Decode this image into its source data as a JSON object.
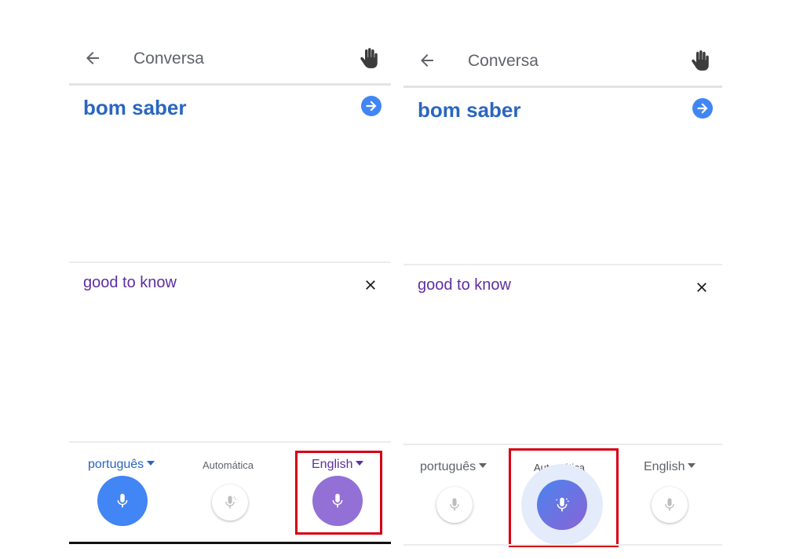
{
  "left": {
    "toolbar": {
      "title": "Conversa",
      "back_icon": "arrow-back-icon",
      "hand_icon": "hand-wave-icon"
    },
    "source_text": "bom saber",
    "target_text": "good to know",
    "languages": {
      "source": "português",
      "auto": "Automática",
      "target": "English"
    },
    "active_mic": "target"
  },
  "right": {
    "toolbar": {
      "title": "Conversa",
      "back_icon": "arrow-back-icon",
      "hand_icon": "hand-wave-icon"
    },
    "source_text": "bom saber",
    "target_text": "good to know",
    "languages": {
      "source": "português",
      "auto": "Automática",
      "target": "English"
    },
    "active_mic": "auto"
  },
  "colors": {
    "source_text": "#2a66c0",
    "target_text": "#5e2ea1",
    "mic_blue": "#4285f4",
    "mic_purple": "#9270d6",
    "highlight_box": "#d6000f"
  }
}
